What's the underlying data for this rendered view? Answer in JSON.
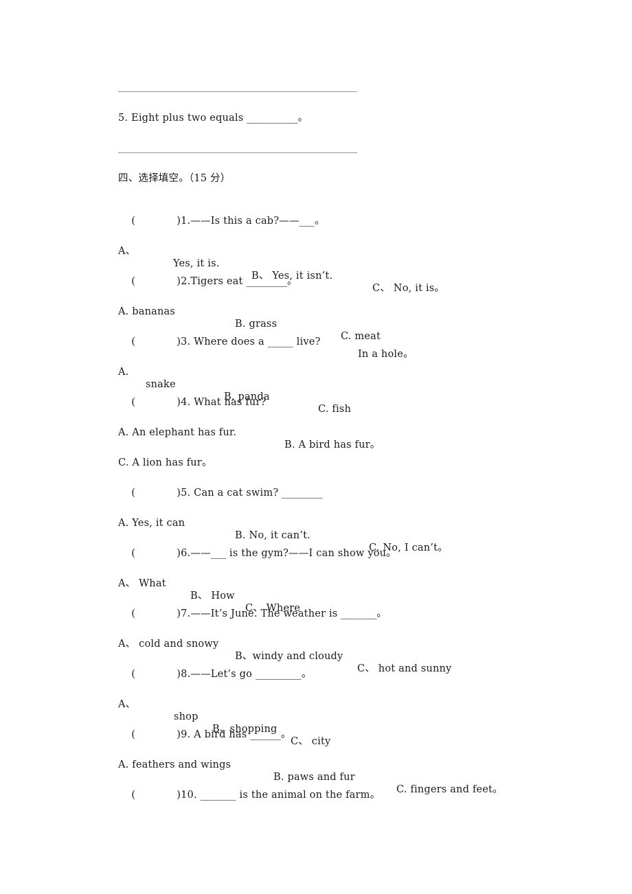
{
  "answer_lines": [
    "",
    ""
  ],
  "prev_item": "5. Eight plus two equals __________。",
  "section": {
    "title": "四、选择填空。（15 分）"
  },
  "questions": [
    {
      "paren": "(",
      "stem": ")1.——Is this a cab?——___。",
      "options": [
        "A、",
        "Yes, it is.",
        "B、 Yes, it isn’t.",
        "C、 No, it is。"
      ]
    },
    {
      "paren": "(",
      "stem": ")2.Tigers eat ________。",
      "options": [
        "A. bananas",
        "B. grass",
        "C. meat"
      ]
    },
    {
      "paren": "(",
      "stem": ")3. Where does a _____ live?",
      "extra": "In a hole。",
      "options": [
        "A.",
        "snake",
        "B. panda",
        "C. fish"
      ]
    },
    {
      "paren": "(",
      "stem": ")4. What has fur?",
      "options": [
        "A. An elephant has fur.",
        "B. A bird has fur。",
        "C. A lion has fur。"
      ]
    },
    {
      "paren": "(",
      "stem": ")5. Can a cat swim? ________",
      "options": [
        "A. Yes, it can",
        "B. No, it can’t.",
        "C. No, I can’t。"
      ]
    },
    {
      "paren": "(",
      "stem": ")6.——___ is the gym?——I can show you。",
      "options": [
        "A、 What",
        "B、 How",
        "C、 Where"
      ]
    },
    {
      "paren": "(",
      "stem": ")7.——It’s June. The weather is _______。",
      "options": [
        "A、 cold and snowy",
        "B、windy and cloudy",
        "C、 hot and sunny"
      ]
    },
    {
      "paren": "(",
      "stem": ")8.——Let’s go _________。",
      "options": [
        "A、",
        "shop",
        "B、shopping",
        "C、 city"
      ]
    },
    {
      "paren": "(",
      "stem": ")9. A bird has ______。",
      "options": [
        "A. feathers and wings",
        "B. paws and fur",
        "C. fingers and feet。"
      ]
    },
    {
      "paren": "(",
      "stem": ")10. _______ is the animal on the farm。"
    }
  ]
}
